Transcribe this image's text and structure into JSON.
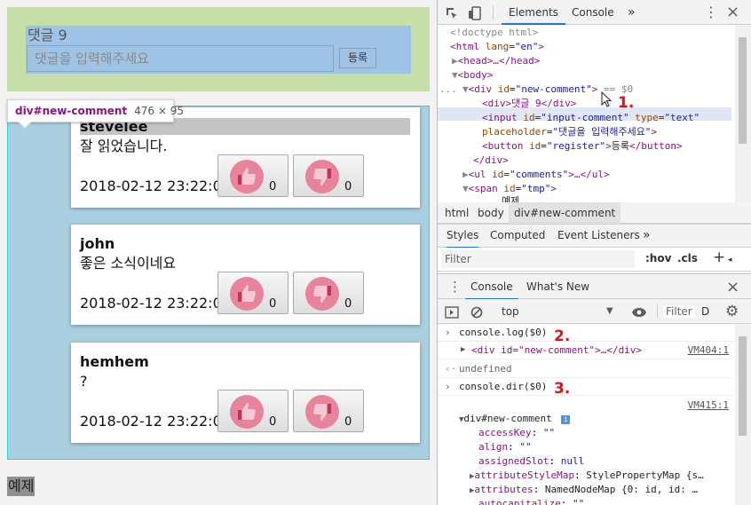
{
  "page": {
    "new_comment": {
      "count_text": "댓글 9",
      "input_placeholder": "댓글을 입력해주세요",
      "register_label": "등록"
    },
    "tooltip": {
      "tag": "div",
      "selector": "#new-comment",
      "size": "476 × 95"
    },
    "comments": [
      {
        "author": "stevelee",
        "text": "잘 읽었습니다.",
        "date": "2018-02-12 23:22:00",
        "likes": "0",
        "dislikes": "0"
      },
      {
        "author": "john",
        "text": "좋은 소식이네요",
        "date": "2018-02-12 23:22:00",
        "likes": "0",
        "dislikes": "0"
      },
      {
        "author": "hemhem",
        "text": "?",
        "date": "2018-02-12 23:22:00",
        "likes": "0",
        "dislikes": "0"
      }
    ],
    "tmp_text": "예제",
    "colors": {
      "margin": "#c6dfa9",
      "content": "#9fc3e5",
      "padding_highlight": "#a9cfe0",
      "vote_circle": "#e8839c"
    }
  },
  "devtools": {
    "tabs": [
      "Elements",
      "Console"
    ],
    "more": "»",
    "close": "×",
    "dom": {
      "doctype": "<!doctype html>",
      "html_open": "<html",
      "html_attr": " lang",
      "html_val": "\"en\"",
      "html_close": ">",
      "head": "<head>…</head>",
      "body": "<body>",
      "ellipsis": "...",
      "div_open": "<div",
      "id_attr": " id",
      "div_id": "\"new-comment\"",
      "eq_sel": "== $0",
      "inner_div": "<div>댓글 9</div>",
      "input_open": "<input",
      "input_id": "\"input-comment\"",
      "type_attr": " type",
      "input_type": "\"text\"",
      "placeholder_attr": "placeholder",
      "placeholder_val": "\"댓글을 입력해주세요\"",
      "button_open": "<button",
      "button_id": "\"register\"",
      "button_text": "등록",
      "button_close": "</button>",
      "div_close": "</div>",
      "ul_open": "<ul",
      "ul_id": "\"comments\"",
      "ul_rest": ">…</ul>",
      "span_open": "<span",
      "span_id": "\"tmp\"",
      "span_text": "예제"
    },
    "annotations": [
      "1.",
      "2.",
      "3."
    ],
    "breadcrumb": [
      "html",
      "body",
      "div#new-comment"
    ],
    "style_tabs": [
      "Styles",
      "Computed",
      "Event Listeners",
      "»"
    ],
    "filter_placeholder": "Filter",
    "hov": ":hov",
    "cls": ".cls",
    "plus": "+",
    "console_tabs": [
      "Console",
      "What's New"
    ],
    "context": "top",
    "console_filter": "Filter",
    "level": "D",
    "console": {
      "cmd1": "console.log($0)",
      "out1": "<div id=\"new-comment\">…</div>",
      "src1": "VM404:1",
      "undef": "undefined",
      "cmd2": "console.dir($0)",
      "src2": "VM415:1",
      "obj": "div#new-comment",
      "props": [
        {
          "key": "accessKey",
          "val": "\"\""
        },
        {
          "key": "align",
          "val": "\"\""
        },
        {
          "key": "assignedSlot",
          "val": "null"
        },
        {
          "key": "attributeStyleMap",
          "val": "StylePropertyMap {s…"
        },
        {
          "key": "attributes",
          "val": "NamedNodeMap {0: id, id: …"
        },
        {
          "key": "autocapitalize",
          "val": "\"\""
        }
      ]
    }
  }
}
